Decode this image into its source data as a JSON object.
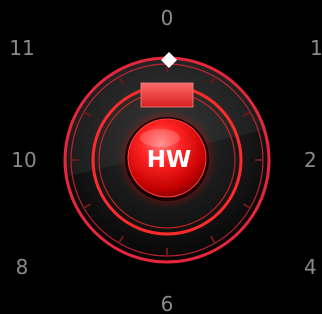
{
  "dial": {
    "hub_label": "HW",
    "position_marker_icon": "diamond",
    "scale": {
      "n0": "0",
      "n1": "1",
      "n2": "2",
      "n4": "4",
      "n6": "6",
      "n8": "8",
      "n10": "10",
      "n11": "11"
    }
  },
  "colors": {
    "accent": "#ff2a2a",
    "ring": "#e6263a",
    "background": "#000000",
    "scale_text": "#8a8a8a"
  }
}
